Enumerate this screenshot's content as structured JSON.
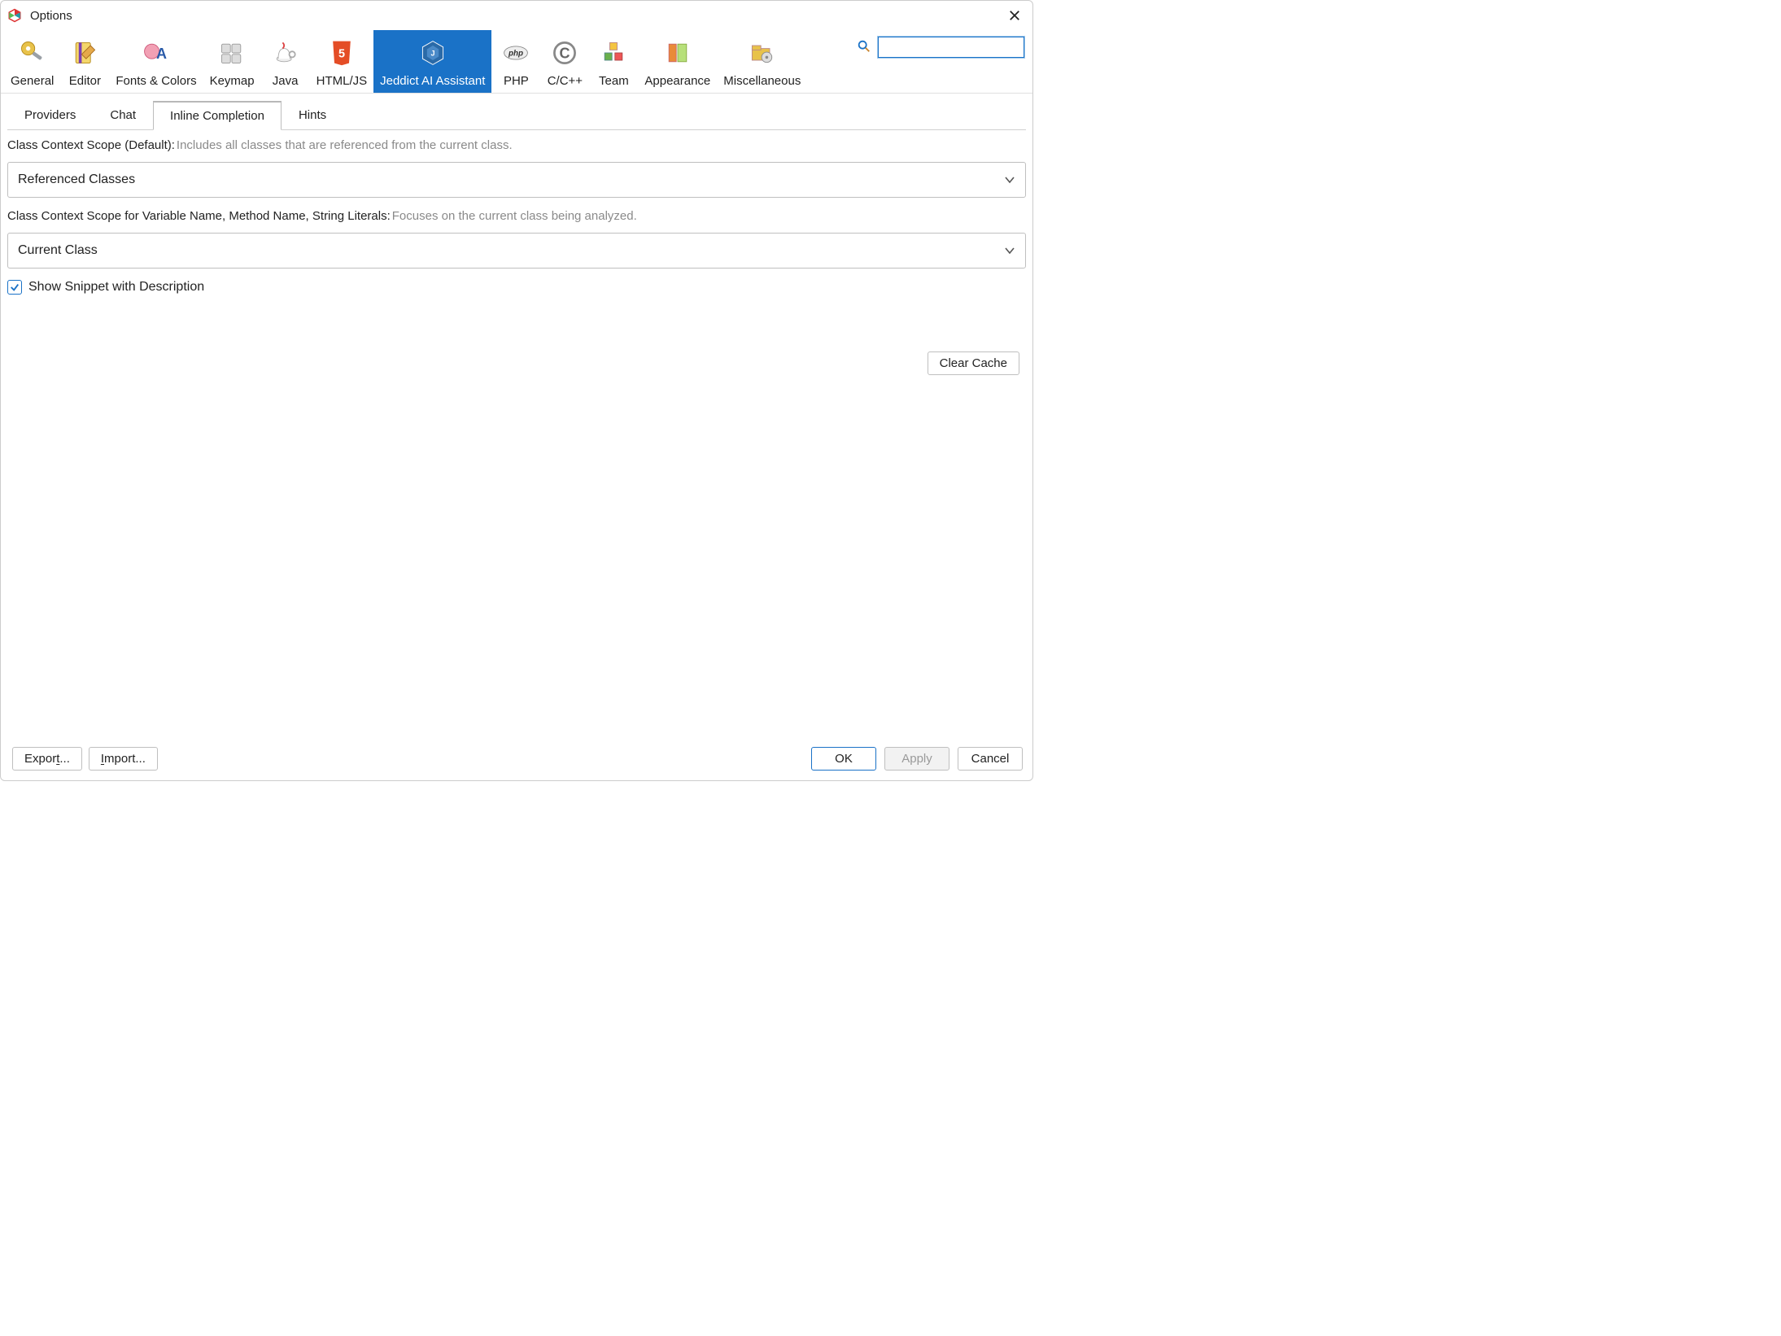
{
  "window": {
    "title": "Options"
  },
  "search": {
    "placeholder": ""
  },
  "categories": [
    {
      "id": "general",
      "label": "General"
    },
    {
      "id": "editor",
      "label": "Editor"
    },
    {
      "id": "fonts",
      "label": "Fonts & Colors"
    },
    {
      "id": "keymap",
      "label": "Keymap"
    },
    {
      "id": "java",
      "label": "Java"
    },
    {
      "id": "htmljs",
      "label": "HTML/JS"
    },
    {
      "id": "jeddict",
      "label": "Jeddict AI Assistant",
      "selected": true
    },
    {
      "id": "php",
      "label": "PHP"
    },
    {
      "id": "ccpp",
      "label": "C/C++"
    },
    {
      "id": "team",
      "label": "Team"
    },
    {
      "id": "appearance",
      "label": "Appearance"
    },
    {
      "id": "misc",
      "label": "Miscellaneous"
    }
  ],
  "subtabs": [
    {
      "id": "providers",
      "label": "Providers"
    },
    {
      "id": "chat",
      "label": "Chat"
    },
    {
      "id": "inline",
      "label": "Inline Completion",
      "active": true
    },
    {
      "id": "hints",
      "label": "Hints"
    }
  ],
  "content": {
    "scope1_label": "Class Context Scope (Default):",
    "scope1_hint": "Includes all classes that are referenced from the current class.",
    "scope1_value": "Referenced Classes",
    "scope2_label": "Class Context Scope for Variable Name, Method Name, String Literals:",
    "scope2_hint": "Focuses on the current class being analyzed.",
    "scope2_value": "Current Class",
    "show_snippet_label": "Show Snippet with Description",
    "show_snippet_checked": true,
    "clear_cache": "Clear Cache"
  },
  "footer": {
    "export": "Export...",
    "import": "Import...",
    "ok": "OK",
    "apply": "Apply",
    "cancel": "Cancel"
  }
}
